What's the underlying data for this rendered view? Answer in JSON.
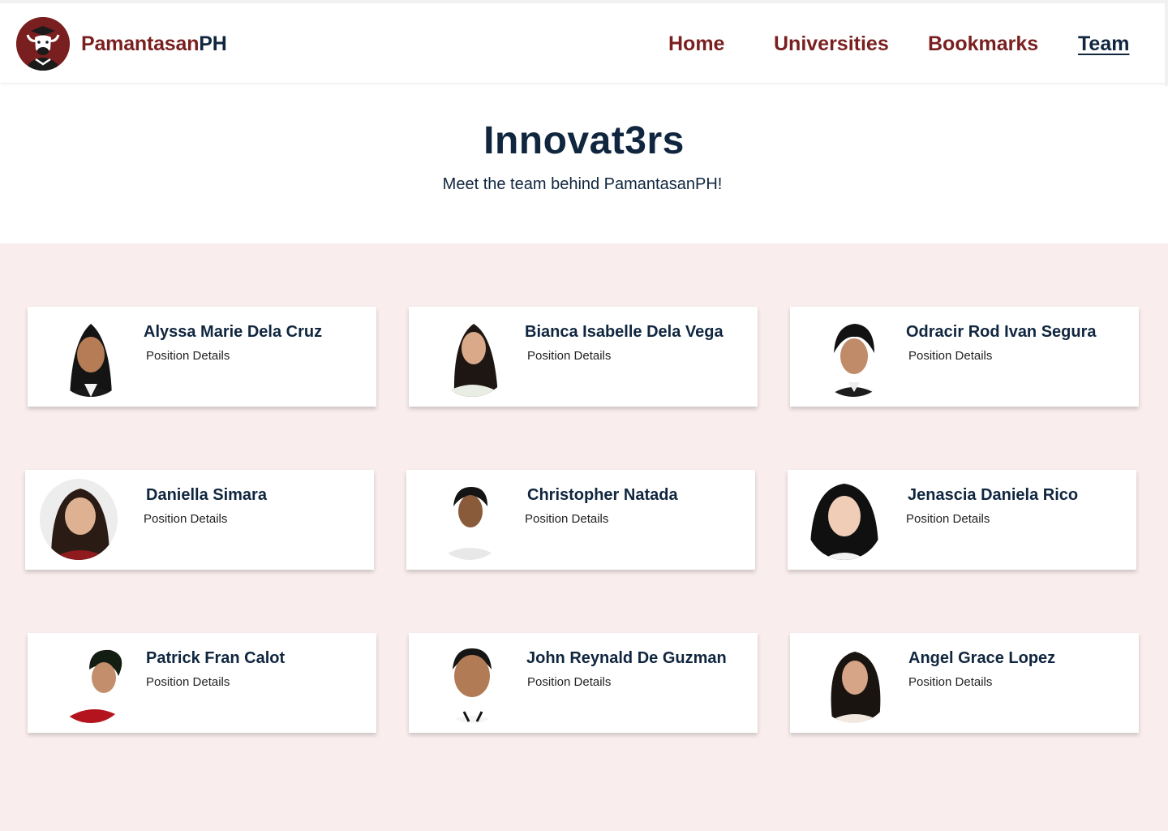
{
  "brand": {
    "name_part1": "Pamantasan",
    "name_part2": "PH",
    "logo_icon": "carabao-graduate-logo"
  },
  "nav": {
    "items": [
      {
        "label": "Home",
        "active": false
      },
      {
        "label": "Universities",
        "active": false
      },
      {
        "label": "Bookmarks",
        "active": false
      },
      {
        "label": "Team",
        "active": true
      }
    ]
  },
  "hero": {
    "title": "Innovat3rs",
    "subtitle": "Meet the team behind PamantasanPH!"
  },
  "colors": {
    "brand_red": "#7a1f1f",
    "navy": "#10263f",
    "team_bg": "#f9eded"
  },
  "members": [
    {
      "name": "Alyssa Marie Dela Cruz",
      "position": "Position Details"
    },
    {
      "name": "Bianca Isabelle Dela Vega",
      "position": "Position Details"
    },
    {
      "name": "Odracir Rod Ivan Segura",
      "position": "Position Details"
    },
    {
      "name": "Daniella Simara",
      "position": "Position Details"
    },
    {
      "name": "Christopher Natada",
      "position": "Position Details"
    },
    {
      "name": "Jenascia Daniela Rico",
      "position": "Position Details"
    },
    {
      "name": "Patrick Fran Calot",
      "position": "Position Details"
    },
    {
      "name": "John Reynald De Guzman",
      "position": "Position Details"
    },
    {
      "name": "Angel Grace Lopez",
      "position": "Position Details"
    }
  ]
}
